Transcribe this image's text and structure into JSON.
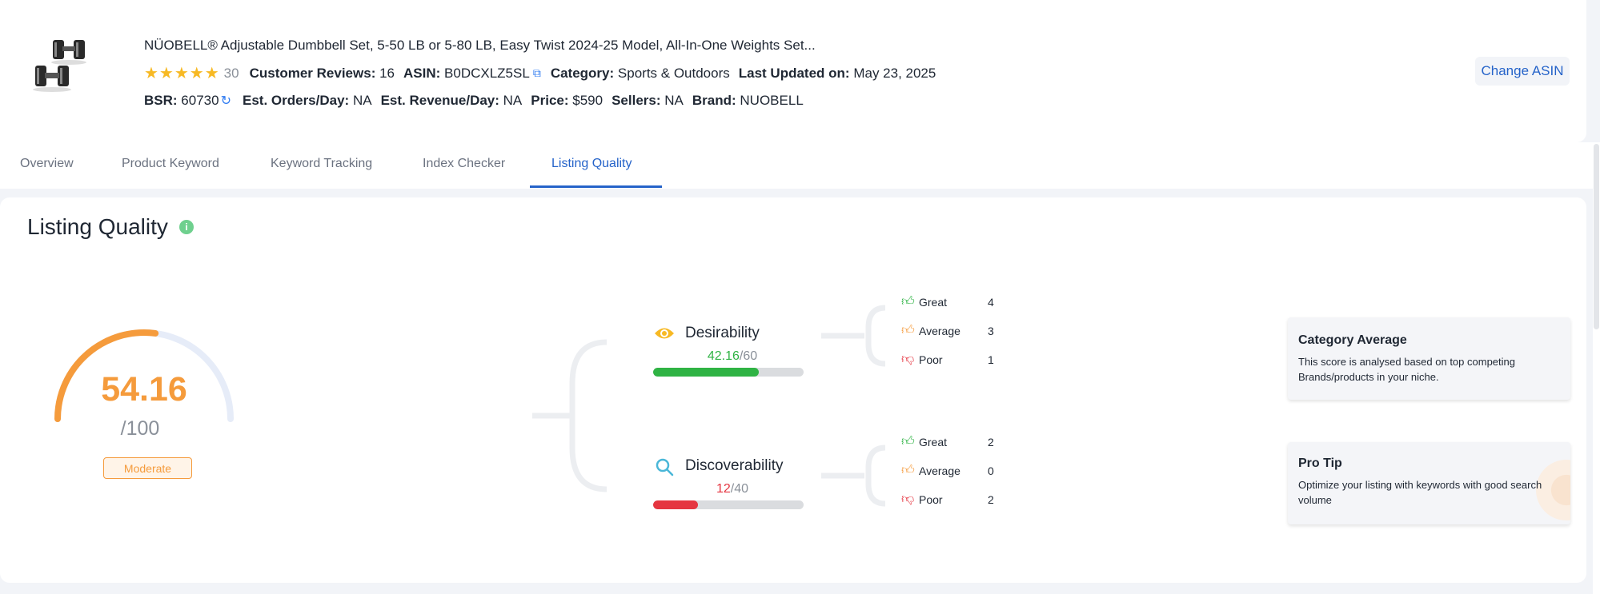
{
  "product": {
    "title": "NÜOBELL® Adjustable Dumbbell Set, 5-50 LB or 5-80 LB, Easy Twist 2024-25 Model, All-In-One Weights Set...",
    "stars": "★★★★★",
    "rating_count": "30",
    "reviews_label": "Customer Reviews:",
    "reviews_value": "16",
    "asin_label": "ASIN:",
    "asin_value": "B0DCXLZ5SL",
    "category_label": "Category:",
    "category_value": "Sports & Outdoors",
    "updated_label": "Last Updated on:",
    "updated_value": "May 23, 2025",
    "bsr_label": "BSR:",
    "bsr_value": "60730",
    "orders_label": "Est. Orders/Day:",
    "orders_value": "NA",
    "revenue_label": "Est. Revenue/Day:",
    "revenue_value": "NA",
    "price_label": "Price:",
    "price_value": "$590",
    "sellers_label": "Sellers:",
    "sellers_value": "NA",
    "brand_label": "Brand:",
    "brand_value": "NUOBELL",
    "change_asin_label": "Change ASIN"
  },
  "tabs": [
    {
      "label": "Overview"
    },
    {
      "label": "Product Keyword"
    },
    {
      "label": "Keyword Tracking"
    },
    {
      "label": "Index Checker"
    },
    {
      "label": "Listing Quality",
      "active": true
    }
  ],
  "listing_quality": {
    "title": "Listing Quality",
    "info_glyph": "i",
    "score": "54.16",
    "score_max": "/100",
    "score_fraction": 0.5416,
    "rating_badge": "Moderate",
    "gauge_color": "#f59b3c",
    "desirability": {
      "label": "Desirability",
      "icon": "eye-icon",
      "score": "42.16",
      "max": "/60",
      "fraction": 0.7027,
      "bar_color": "#2fb344",
      "counts": [
        {
          "label": "Great",
          "value": "4",
          "icon": "thumbs-up-icon"
        },
        {
          "label": "Average",
          "value": "3",
          "icon": "thumbs-up-icon"
        },
        {
          "label": "Poor",
          "value": "1",
          "icon": "thumbs-down-icon"
        }
      ]
    },
    "discoverability": {
      "label": "Discoverability",
      "icon": "search-icon",
      "score": "12",
      "max": "/40",
      "fraction": 0.3,
      "bar_color": "#e53540",
      "counts": [
        {
          "label": "Great",
          "value": "2",
          "icon": "thumbs-up-icon"
        },
        {
          "label": "Average",
          "value": "0",
          "icon": "thumbs-up-icon"
        },
        {
          "label": "Poor",
          "value": "2",
          "icon": "thumbs-down-icon"
        }
      ]
    },
    "category_average": {
      "title": "Category Average",
      "text": "This score is analysed based on top competing Brands/products in your niche."
    },
    "pro_tip": {
      "title": "Pro Tip",
      "text": "Optimize your listing with keywords with good search volume"
    }
  }
}
